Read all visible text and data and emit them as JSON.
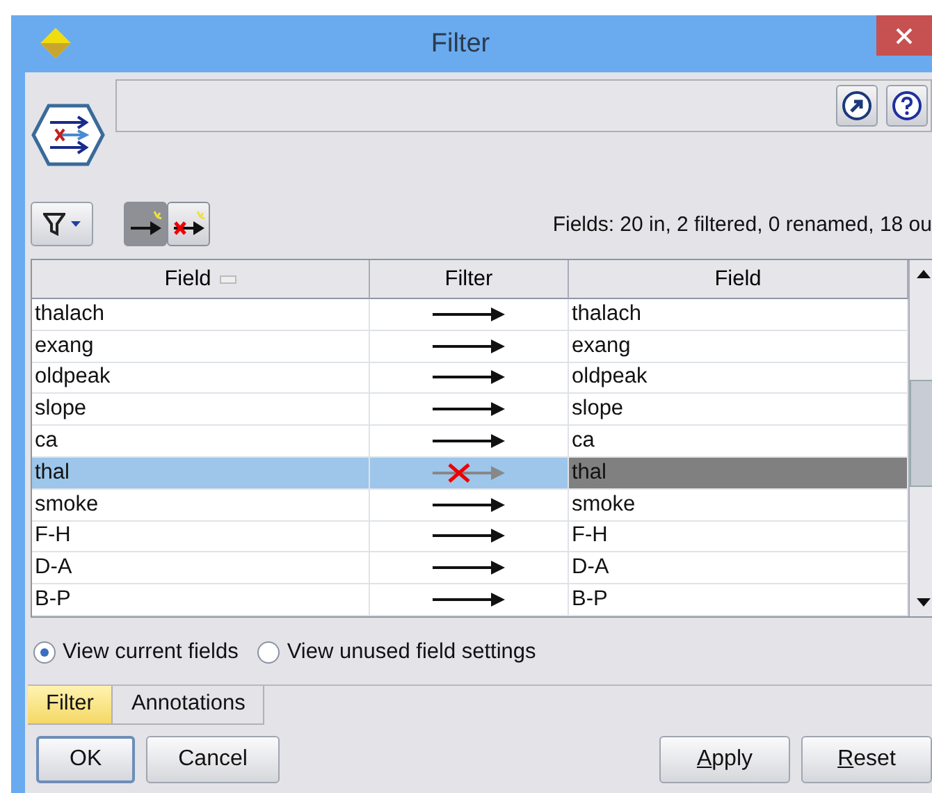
{
  "window": {
    "title": "Filter"
  },
  "toolbar": {
    "status": "Fields: 20 in, 2 filtered, 0 renamed, 18 ou",
    "buttons": [
      {
        "kind": "pass",
        "pressed": true
      },
      {
        "kind": "remove",
        "pressed": false
      }
    ]
  },
  "table": {
    "columns": [
      "Field",
      "Filter",
      "Field"
    ],
    "rows": [
      {
        "field": "thalach",
        "output": "thalach",
        "filtered": false,
        "selected": false
      },
      {
        "field": "exang",
        "output": "exang",
        "filtered": false,
        "selected": false
      },
      {
        "field": "oldpeak",
        "output": "oldpeak",
        "filtered": false,
        "selected": false
      },
      {
        "field": "slope",
        "output": "slope",
        "filtered": false,
        "selected": false
      },
      {
        "field": "ca",
        "output": "ca",
        "filtered": false,
        "selected": false
      },
      {
        "field": "thal",
        "output": "thal",
        "filtered": true,
        "selected": true
      },
      {
        "field": "smoke",
        "output": "smoke",
        "filtered": false,
        "selected": false
      },
      {
        "field": "F-H",
        "output": "F-H",
        "filtered": false,
        "selected": false
      },
      {
        "field": "D-A",
        "output": "D-A",
        "filtered": false,
        "selected": false
      },
      {
        "field": "B-P",
        "output": "B-P",
        "filtered": false,
        "selected": false
      }
    ]
  },
  "view_options": [
    {
      "label": "View current fields",
      "selected": true
    },
    {
      "label": "View unused field settings",
      "selected": false
    }
  ],
  "tabs": [
    {
      "label": "Filter",
      "selected": true
    },
    {
      "label": "Annotations",
      "selected": false
    }
  ],
  "buttons_left": [
    {
      "label": "OK",
      "default": true,
      "underline_first": false
    },
    {
      "label": "Cancel",
      "default": false,
      "underline_first": false
    }
  ],
  "buttons_right": [
    {
      "label": "Apply",
      "default": false,
      "underline_first": true
    },
    {
      "label": "Reset",
      "default": false,
      "underline_first": true
    }
  ]
}
